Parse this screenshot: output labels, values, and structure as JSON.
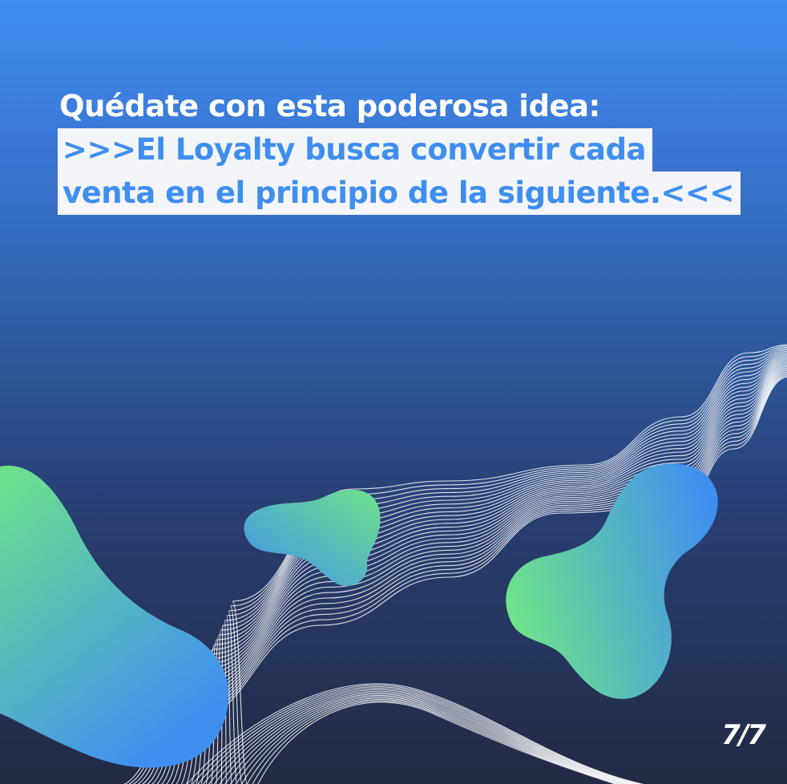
{
  "slide": {
    "headline": "Quédate con esta poderosa idea:",
    "quote_lines": [
      ">>>El Loyalty busca convertir cada",
      "venta en el principio de la siguiente.<<<"
    ],
    "page_indicator": "7/7"
  },
  "colors": {
    "background_top": "#3f8ff0",
    "background_bottom": "#222a44",
    "highlight_bg": "#f3f5f9",
    "highlight_text": "#3e8ef0",
    "blob_green": "#6fe38a",
    "blob_blue": "#3f8ff0"
  }
}
